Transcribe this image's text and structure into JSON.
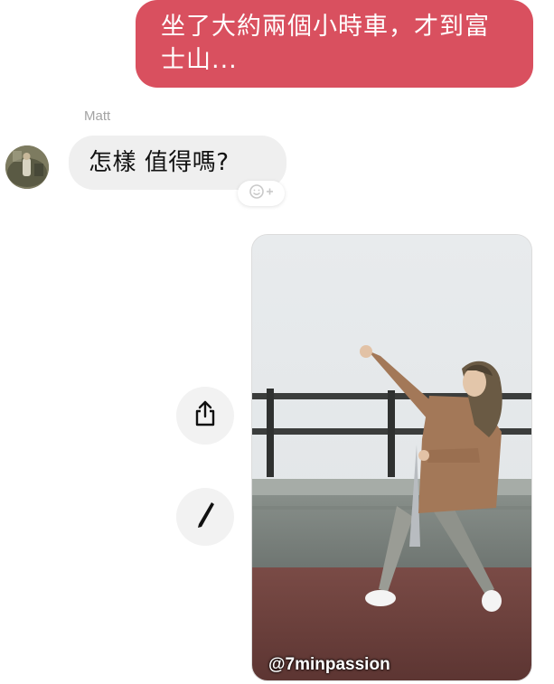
{
  "messages": {
    "outgoing": {
      "text": "坐了大約兩個小時車，才到富士山...",
      "color": "#d9505f"
    },
    "incoming": {
      "sender": "Matt",
      "text": "怎樣 值得嗎?",
      "bubble_color": "#efefef"
    }
  },
  "icons": {
    "reaction": "add-reaction-icon",
    "share": "share-icon",
    "edit": "pencil-icon"
  },
  "photo": {
    "watermark": "@7minpassion"
  }
}
